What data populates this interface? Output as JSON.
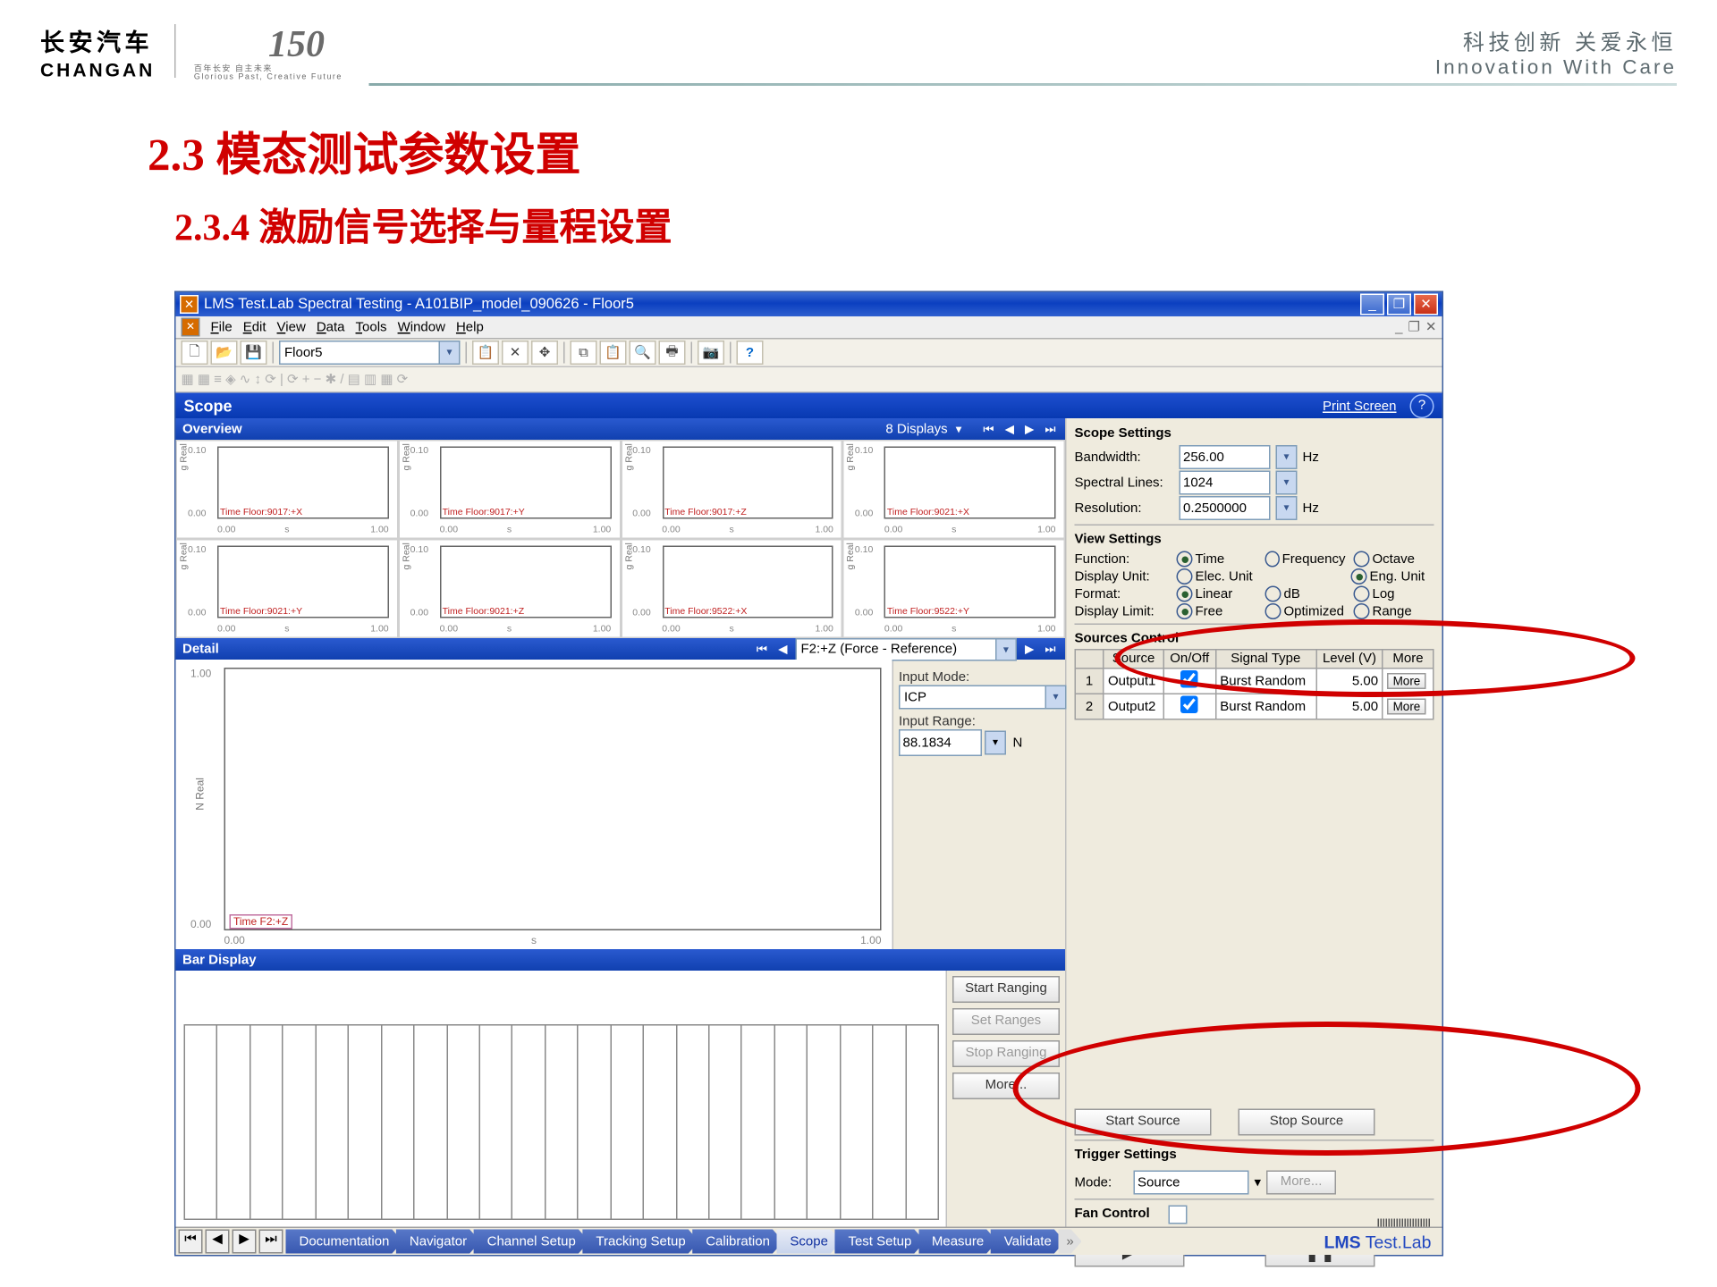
{
  "header": {
    "logo_zh": "长安汽车",
    "logo_en": "CHANGAN",
    "logo_150": "150",
    "logo_sub_zh": "百年长安  自主未来",
    "logo_sub_en": "Glorious Past, Creative Future",
    "slogan_zh": "科技创新  关爱永恒",
    "slogan_en": "Innovation With Care"
  },
  "titles": {
    "h1": "2.3 模态测试参数设置",
    "h2": "2.3.4 激励信号选择与量程设置"
  },
  "window": {
    "title": "LMS Test.Lab Spectral Testing - A101BIP_model_090626 - Floor5",
    "menu": [
      "File",
      "Edit",
      "View",
      "Data",
      "Tools",
      "Window",
      "Help"
    ],
    "toolbar_project": "Floor5",
    "scope_title": "Scope",
    "print_screen": "Print Screen"
  },
  "overview": {
    "title": "Overview",
    "displays_label": "8 Displays",
    "charts": [
      {
        "ymax": "0.10",
        "ymin": "0.00",
        "xmin": "0.00",
        "xmax": "1.00",
        "xunit": "s",
        "ylbl": "g\nReal",
        "legend": "Time Floor:9017:+X"
      },
      {
        "ymax": "0.10",
        "ymin": "0.00",
        "xmin": "0.00",
        "xmax": "1.00",
        "xunit": "s",
        "ylbl": "g\nReal",
        "legend": "Time Floor:9017:+Y"
      },
      {
        "ymax": "0.10",
        "ymin": "0.00",
        "xmin": "0.00",
        "xmax": "1.00",
        "xunit": "s",
        "ylbl": "g\nReal",
        "legend": "Time Floor:9017:+Z"
      },
      {
        "ymax": "0.10",
        "ymin": "0.00",
        "xmin": "0.00",
        "xmax": "1.00",
        "xunit": "s",
        "ylbl": "g\nReal",
        "legend": "Time Floor:9021:+X"
      },
      {
        "ymax": "0.10",
        "ymin": "0.00",
        "xmin": "0.00",
        "xmax": "1.00",
        "xunit": "s",
        "ylbl": "g\nReal",
        "legend": "Time Floor:9021:+Y"
      },
      {
        "ymax": "0.10",
        "ymin": "0.00",
        "xmin": "0.00",
        "xmax": "1.00",
        "xunit": "s",
        "ylbl": "g\nReal",
        "legend": "Time Floor:9021:+Z"
      },
      {
        "ymax": "0.10",
        "ymin": "0.00",
        "xmin": "0.00",
        "xmax": "1.00",
        "xunit": "s",
        "ylbl": "g\nReal",
        "legend": "Time Floor:9522:+X"
      },
      {
        "ymax": "0.10",
        "ymin": "0.00",
        "xmin": "0.00",
        "xmax": "1.00",
        "xunit": "s",
        "ylbl": "g\nReal",
        "legend": "Time Floor:9522:+Y"
      }
    ]
  },
  "detail": {
    "title": "Detail",
    "selected": "F2:+Z (Force - Reference)",
    "chart": {
      "ymax": "1.00",
      "ymin": "0.00",
      "xmin": "0.00",
      "xmax": "1.00",
      "xunit": "s",
      "ylbl": "N\nReal",
      "legend": "Time F2:+Z"
    },
    "input_mode_label": "Input Mode:",
    "input_mode": "ICP",
    "input_range_label": "Input Range:",
    "input_range": "88.1834",
    "input_range_unit": "N"
  },
  "bardisplay": {
    "title": "Bar Display",
    "btns": {
      "start_ranging": "Start Ranging",
      "set_ranges": "Set Ranges",
      "stop_ranging": "Stop Ranging",
      "more": "More..."
    }
  },
  "settings": {
    "scope_settings": "Scope Settings",
    "bandwidth_l": "Bandwidth:",
    "bandwidth_v": "256.00",
    "bandwidth_u": "Hz",
    "spectral_l": "Spectral Lines:",
    "spectral_v": "1024",
    "resolution_l": "Resolution:",
    "resolution_v": "0.2500000",
    "resolution_u": "Hz",
    "view_settings": "View Settings",
    "function_l": "Function:",
    "func_time": "Time",
    "func_freq": "Frequency",
    "func_oct": "Octave",
    "dispunit_l": "Display Unit:",
    "du_elec": "Elec. Unit",
    "du_eng": "Eng. Unit",
    "format_l": "Format:",
    "fmt_lin": "Linear",
    "fmt_db": "dB",
    "fmt_log": "Log",
    "displim_l": "Display Limit:",
    "dl_free": "Free",
    "dl_opt": "Optimized",
    "dl_rng": "Range",
    "sources_control": "Sources Control",
    "tbl_headers": [
      "Source",
      "On/Off",
      "Signal Type",
      "Level (V)",
      "More"
    ],
    "rows": [
      {
        "n": "1",
        "src": "Output1",
        "on": true,
        "type": "Burst Random",
        "level": "5.00",
        "more": "More"
      },
      {
        "n": "2",
        "src": "Output2",
        "on": true,
        "type": "Burst Random",
        "level": "5.00",
        "more": "More"
      }
    ],
    "start_source": "Start Source",
    "stop_source": "Stop Source",
    "trigger_settings": "Trigger Settings",
    "mode_l": "Mode:",
    "mode_v": "Source",
    "more": "More...",
    "fan_control": "Fan Control",
    "play": "▶",
    "pause": "❚❚"
  },
  "tabs": [
    "Documentation",
    "Navigator",
    "Channel Setup",
    "Tracking Setup",
    "Calibration",
    "Scope",
    "Test Setup",
    "Measure",
    "Validate"
  ],
  "lms": "LMS Test.Lab"
}
